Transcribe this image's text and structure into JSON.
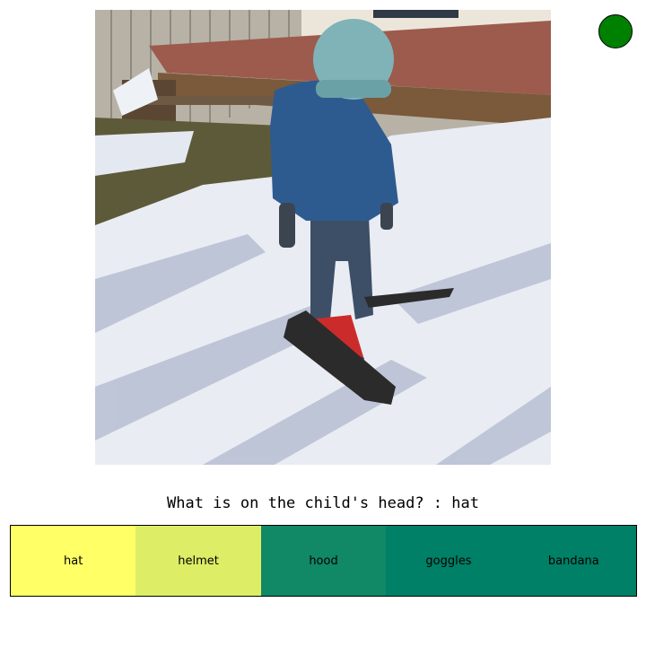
{
  "photo": {
    "subject": "child-in-snow"
  },
  "status": {
    "color": "#008000"
  },
  "question": {
    "text": "What is on the child's head? : hat"
  },
  "answers": [
    {
      "label": "hat",
      "color": "#ffff66"
    },
    {
      "label": "helmet",
      "color": "#ddee66"
    },
    {
      "label": "hood",
      "color": "#118866"
    },
    {
      "label": "goggles",
      "color": "#008066"
    },
    {
      "label": "bandana",
      "color": "#008066"
    }
  ]
}
